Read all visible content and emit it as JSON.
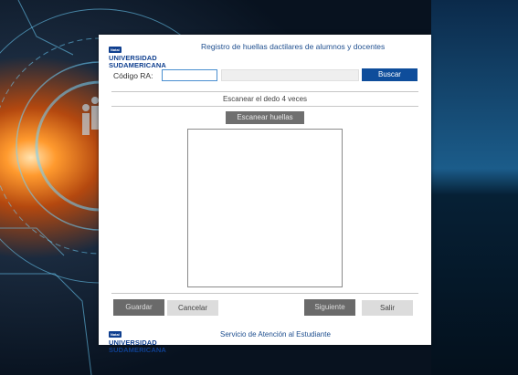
{
  "header": {
    "logo_badge": "Natal",
    "logo_line1": "UNIVERSIDAD",
    "logo_line2": "SUDAMERICANA",
    "title": "Registro de huellas dactilares de alumnos y docentes"
  },
  "form": {
    "ra_label": "Código RA:",
    "ra_value": "",
    "name_value": "",
    "search_button": "Buscar"
  },
  "scan": {
    "instruction": "Escanear el dedo 4 veces",
    "scan_button": "Escanear huellas"
  },
  "actions": {
    "save": "Guardar",
    "cancel": "Cancelar",
    "next": "Siguiente",
    "exit": "Salir"
  },
  "footer": {
    "logo_badge": "Natal",
    "logo_line1": "UNIVERSIDAD",
    "logo_line2": "SUDAMERICANA",
    "text": "Servicio de Atención al Estudiante"
  },
  "colors": {
    "accent": "#0e4d9b",
    "brand": "#0f3f8f",
    "disabled_button": "#6a6a6a",
    "secondary_button": "#dcdcdc"
  }
}
